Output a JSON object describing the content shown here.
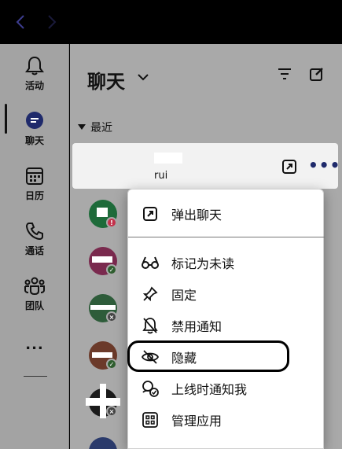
{
  "titlebar": {
    "back_icon": "chevron-left-icon",
    "forward_icon": "chevron-right-icon"
  },
  "rail": {
    "items": [
      {
        "label": "活动",
        "icon": "bell-icon"
      },
      {
        "label": "聊天",
        "icon": "chat-icon",
        "active": true
      },
      {
        "label": "日历",
        "icon": "calendar-icon"
      },
      {
        "label": "通话",
        "icon": "phone-icon"
      },
      {
        "label": "团队",
        "icon": "teams-icon"
      },
      {
        "label": "...",
        "icon": "more-icon"
      }
    ]
  },
  "panel": {
    "title": "聊天",
    "section": "最近",
    "selected_chat": {
      "name_line2": "rui"
    }
  },
  "context_menu": {
    "items": [
      {
        "label": "弹出聊天",
        "icon": "popout-icon"
      },
      {
        "label": "标记为未读",
        "icon": "glasses-icon"
      },
      {
        "label": "固定",
        "icon": "pin-icon"
      },
      {
        "label": "禁用通知",
        "icon": "bell-off-icon"
      },
      {
        "label": "隐藏",
        "icon": "eye-off-icon",
        "highlighted": true
      },
      {
        "label": "上线时通知我",
        "icon": "presence-bell-icon"
      },
      {
        "label": "管理应用",
        "icon": "apps-icon"
      }
    ]
  },
  "avatars": [
    {
      "color": "#1e6b3a",
      "status": "busy",
      "status_color": "#c4314b"
    },
    {
      "color": "#7a2a4e",
      "status": "available",
      "status_color": "#2f5e2f"
    },
    {
      "color": "#2e5c3a",
      "status": "offline",
      "status_color": "#444444"
    },
    {
      "color": "#6b3a2a",
      "status": "available",
      "status_color": "#2f5e2f"
    },
    {
      "color": "#1a1a1a",
      "status": "offline",
      "status_color": "#444444"
    },
    {
      "color": "#2a3a6b",
      "status": "none",
      "status_color": "#2a3a6b"
    }
  ]
}
